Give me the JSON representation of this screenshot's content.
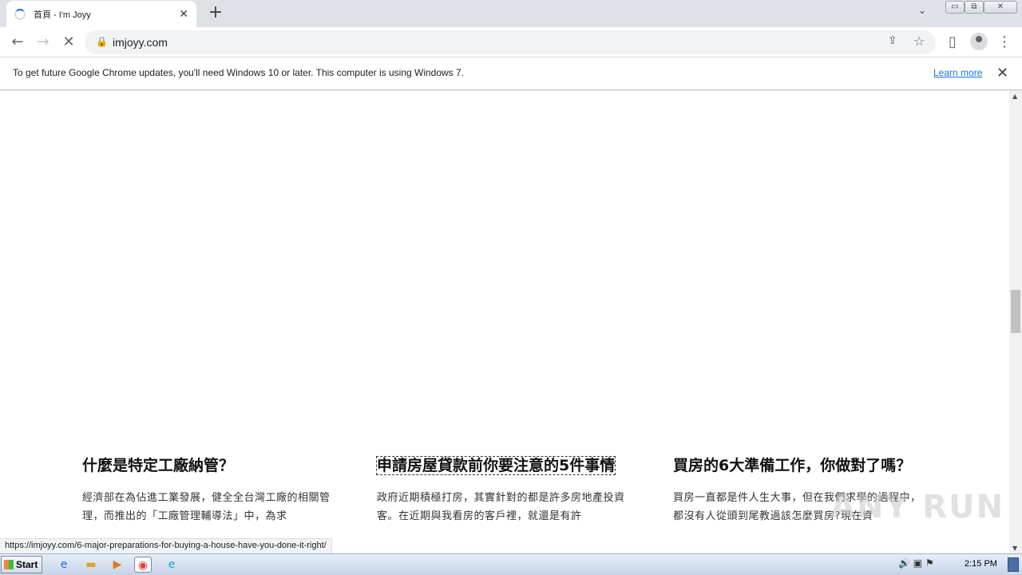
{
  "browser": {
    "tab_title": "首頁 - I'm Joyy",
    "tab_close": "✕",
    "new_tab": "+",
    "tab_menu": "⌄",
    "url": "imjoyy.com",
    "window_controls": [
      "▭",
      "⧉",
      "✕"
    ],
    "back": "←",
    "forward": "→",
    "stop": "✕",
    "share": "⇪",
    "star": "☆",
    "side_panel": "▯",
    "menu": "⋮"
  },
  "infobar": {
    "message": "To get future Google Chrome updates, you'll need Windows 10 or later. This computer is using Windows 7.",
    "learn_more": "Learn more",
    "close": "✕"
  },
  "articles": [
    {
      "title": "什麼是特定工廠納管？",
      "excerpt": "經濟部在為佔進工業發展，健全全台灣工廠的相關管理，而推出的「工廠管理輔導法」中，為求"
    },
    {
      "title": "申請房屋貸款前你要注意的5件事情",
      "excerpt": "政府近期積極打房，其實針對的都是許多房地產投資客。在近期與我看房的客戶裡，就還是有許"
    },
    {
      "title": "買房的6大準備工作，你做對了嗎？",
      "excerpt": "買房一直都是件人生大事，但在我們求學的過程中，都沒有人從頭到尾教過該怎麼買房?現在資"
    }
  ],
  "status_url": "https://imjoyy.com/6-major-preparations-for-buying-a-house-have-you-done-it-right/",
  "watermark": "ANY RUN",
  "taskbar": {
    "start": "Start",
    "clock": "2:15 PM"
  }
}
